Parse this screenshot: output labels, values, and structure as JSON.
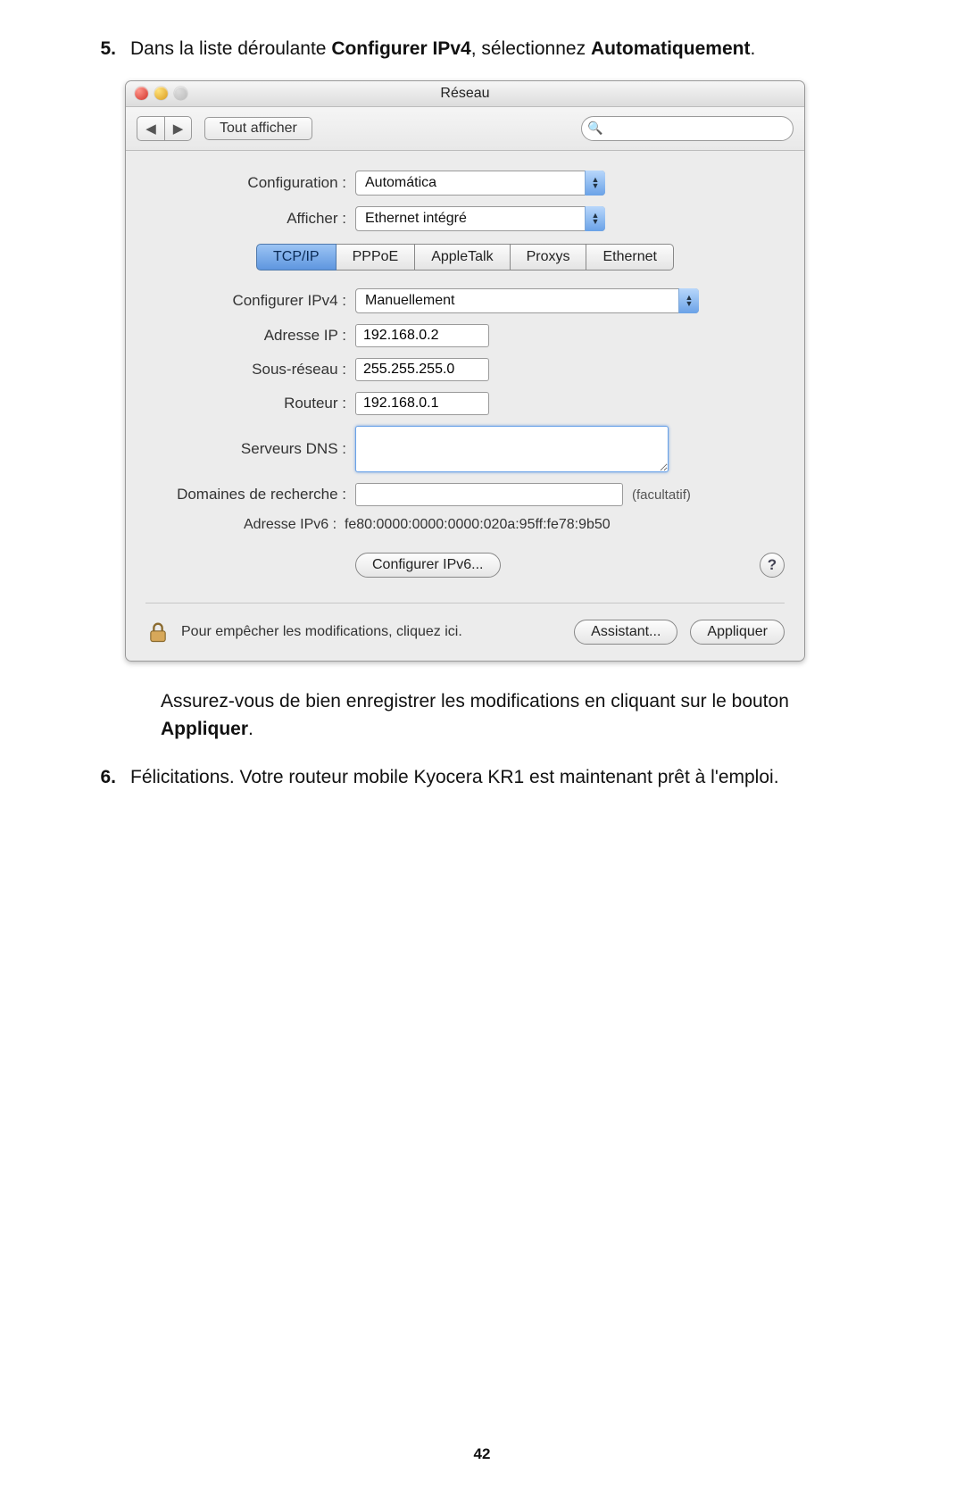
{
  "step5": {
    "num": "5.",
    "t1": "Dans la liste déroulante ",
    "b1": "Configurer IPv4",
    "t2": ", sélectionnez ",
    "b2": "Automatiquement",
    "t3": "."
  },
  "window": {
    "title": "Réseau",
    "show_all": "Tout afficher",
    "search_placeholder": "",
    "config_label": "Configuration :",
    "config_value": "Automática",
    "show_label": "Afficher :",
    "show_value": "Ethernet intégré",
    "tabs": [
      "TCP/IP",
      "PPPoE",
      "AppleTalk",
      "Proxys",
      "Ethernet"
    ],
    "active_tab": 0,
    "cfg_ipv4_label": "Configurer IPv4 :",
    "cfg_ipv4_value": "Manuellement",
    "ip_label": "Adresse IP :",
    "ip_value": "192.168.0.2",
    "subnet_label": "Sous-réseau :",
    "subnet_value": "255.255.255.0",
    "router_label": "Routeur :",
    "router_value": "192.168.0.1",
    "dns_label": "Serveurs DNS :",
    "search_domains_label": "Domaines de recherche :",
    "optional": "(facultatif)",
    "ipv6_label": "Adresse IPv6 :",
    "ipv6_value": "fe80:0000:0000:0000:020a:95ff:fe78:9b50",
    "cfg_ipv6_btn": "Configurer IPv6...",
    "lock_text": "Pour empêcher les modifications, cliquez ici.",
    "assistant_btn": "Assistant...",
    "apply_btn": "Appliquer"
  },
  "para": {
    "t1": "Assurez-vous de bien enregistrer les modifications en cliquant sur le bouton ",
    "b1": "Appliquer",
    "t2": "."
  },
  "step6": {
    "num": "6.",
    "text": "Félicitations. Votre routeur mobile Kyocera KR1 est maintenant prêt à l'emploi."
  },
  "page_number": "42"
}
